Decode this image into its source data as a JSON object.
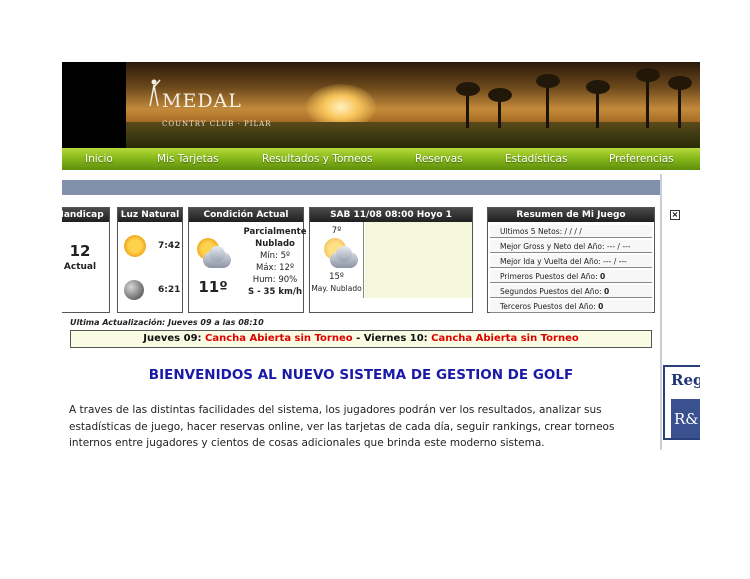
{
  "brand": {
    "name": "MEDAL",
    "subtitle": "COUNTRY CLUB · PILAR"
  },
  "nav": {
    "items": [
      {
        "label": "Inicio"
      },
      {
        "label": "Mis Tarjetas"
      },
      {
        "label": "Resultados y Torneos"
      },
      {
        "label": "Reservas"
      },
      {
        "label": "Estadísticas"
      },
      {
        "label": "Preferencias"
      }
    ]
  },
  "handicap": {
    "header": "Handicap",
    "value": "12",
    "label": "Actual"
  },
  "natural_light": {
    "header": "Luz Natural",
    "sunrise": "7:42",
    "sunset": "6:21"
  },
  "current_condition": {
    "header": "Condición Actual",
    "temp": "11º",
    "desc": "Parcialmente Nublado",
    "min": "Mín: 5º",
    "max": "Máx: 12º",
    "hum": "Hum: 90%",
    "wind": "S - 35 km/h"
  },
  "forecast": {
    "header": "SAB 11/08 08:00 Hoyo 1",
    "low": "7º",
    "high": "15º",
    "desc": "May. Nublado"
  },
  "my_game": {
    "header": "Resumen de Mi Juego",
    "rows": [
      {
        "text": "Ultimos 5 Netos: / / / /"
      },
      {
        "text": "Mejor Gross y Neto del Año: --- / ---"
      },
      {
        "text": "Mejor Ida y Vuelta del Año: --- / ---"
      },
      {
        "text": "Primeros Puestos del Año: ",
        "value": "0"
      },
      {
        "text": "Segundos Puestos del Año: ",
        "value": "0"
      },
      {
        "text": "Terceros Puestos del Año: ",
        "value": "0"
      }
    ]
  },
  "last_update": "Ultima Actualización: Jueves 09 a las 08:10",
  "course_status": {
    "day1": "Jueves 09: ",
    "status1": "Cancha Abierta sin Torneo",
    "sep": " - ",
    "day2": "Viernes 10: ",
    "status2": "Cancha Abierta sin Torneo"
  },
  "welcome_title": "BIENVENIDOS AL NUEVO SISTEMA DE GESTION DE GOLF",
  "intro_text": "A traves de las distintas facilidades del sistema, los jugadores podrán ver los resultados, analizar sus estadísticas de juego, hacer reservas online, ver las tarjetas de cada día, seguir rankings, crear torneos internos entre jugadores y cientos de cosas adicionales que brinda este moderno sistema.",
  "close_glyph": "×",
  "ad": {
    "title": "Reg",
    "logo": "R&"
  },
  "colors": {
    "nav_green": "#88ba1c",
    "status_red": "#e00000",
    "welcome_blue": "#1a1aa8",
    "strip_blue": "#8290ab"
  }
}
